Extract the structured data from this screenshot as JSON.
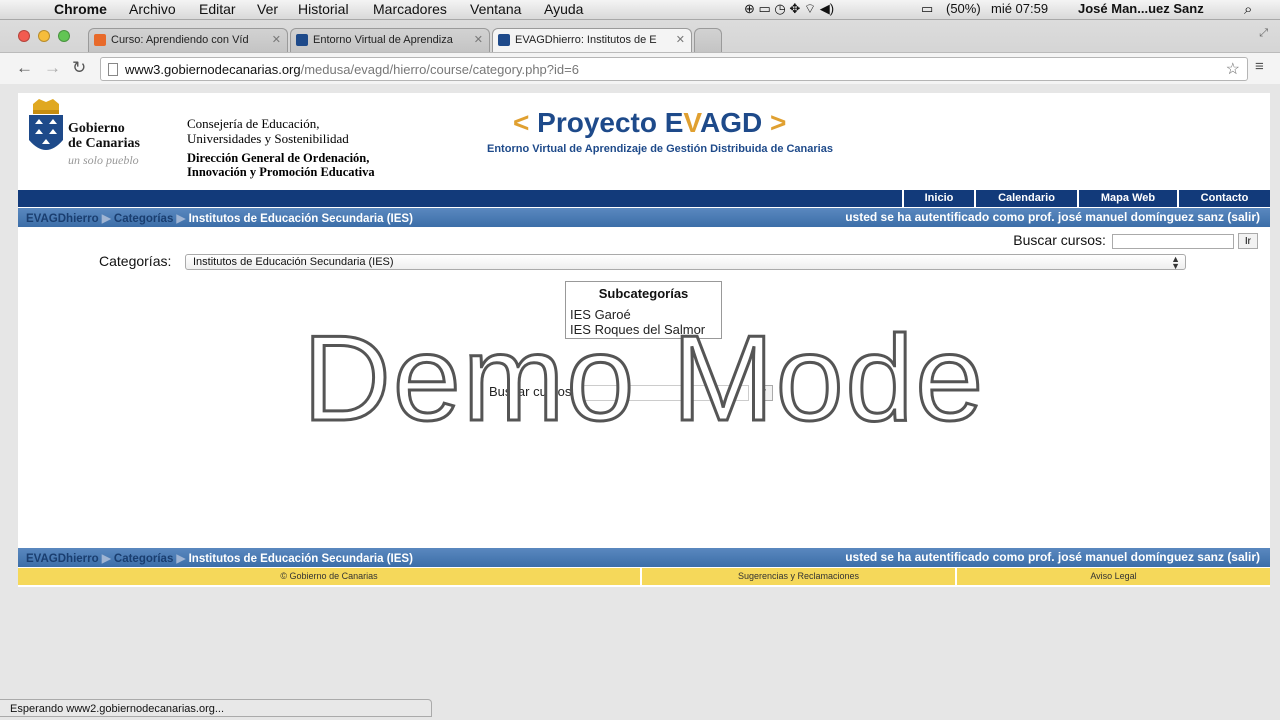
{
  "menubar": {
    "app": "Chrome",
    "items": [
      "Archivo",
      "Editar",
      "Ver",
      "Historial",
      "Marcadores",
      "Ventana",
      "Ayuda"
    ],
    "battery": "(50%)",
    "clock": "mié 07:59",
    "user": "José Man...uez Sanz"
  },
  "tabs": [
    {
      "label": "Curso: Aprendiendo con Víd",
      "color": "#e86a2a"
    },
    {
      "label": "Entorno Virtual de Aprendiza",
      "color": "#1e4a8a"
    },
    {
      "label": "EVAGDhierro: Institutos de E",
      "color": "#1e4a8a"
    }
  ],
  "address": {
    "host": "www3.gobiernodecanarias.org",
    "path": "/medusa/evagd/hierro/course/category.php?id=6"
  },
  "header": {
    "gob_line1": "Gobierno",
    "gob_line2": "de Canarias",
    "pueblo": "un solo pueblo",
    "consejeria1": "Consejería de Educación,",
    "consejeria2": "Universidades y Sostenibilidad",
    "direccion1": "Dirección General de Ordenación,",
    "direccion2": "Innovación y Promoción Educativa",
    "proyecto_open": "<",
    "proyecto_name_a": "Proyecto E",
    "proyecto_name_v": "V",
    "proyecto_name_b": "AGD",
    "proyecto_close": ">",
    "proyecto_sub": "Entorno Virtual de Aprendizaje de Gestión Distribuida de Canarias"
  },
  "navlinks": [
    "Inicio",
    "Calendario",
    "Mapa Web",
    "Contacto"
  ],
  "breadcrumb": {
    "c1": "EVAGDhierro",
    "c2": "Categorías",
    "c3": "Institutos de Educación Secundaria (IES)",
    "sep": "▶",
    "auth_text": "usted se ha autentificado como",
    "user": "prof. josé manuel domínguez sanz",
    "logout": "(salir)"
  },
  "search": {
    "label": "Buscar cursos:",
    "button": "Ir"
  },
  "categories": {
    "label": "Categorías:",
    "selected": "Institutos de Educación Secundaria (IES)"
  },
  "subcategories": {
    "title": "Subcategorías",
    "items": [
      "IES Garoé",
      "IES Roques del Salmor"
    ]
  },
  "watermark": "Demo Mode",
  "footer": {
    "copyright": "© Gobierno de Canarias",
    "sugerencias": "Sugerencias y Reclamaciones",
    "aviso": "Aviso Legal"
  },
  "status": "Esperando www2.gobiernodecanarias.org..."
}
